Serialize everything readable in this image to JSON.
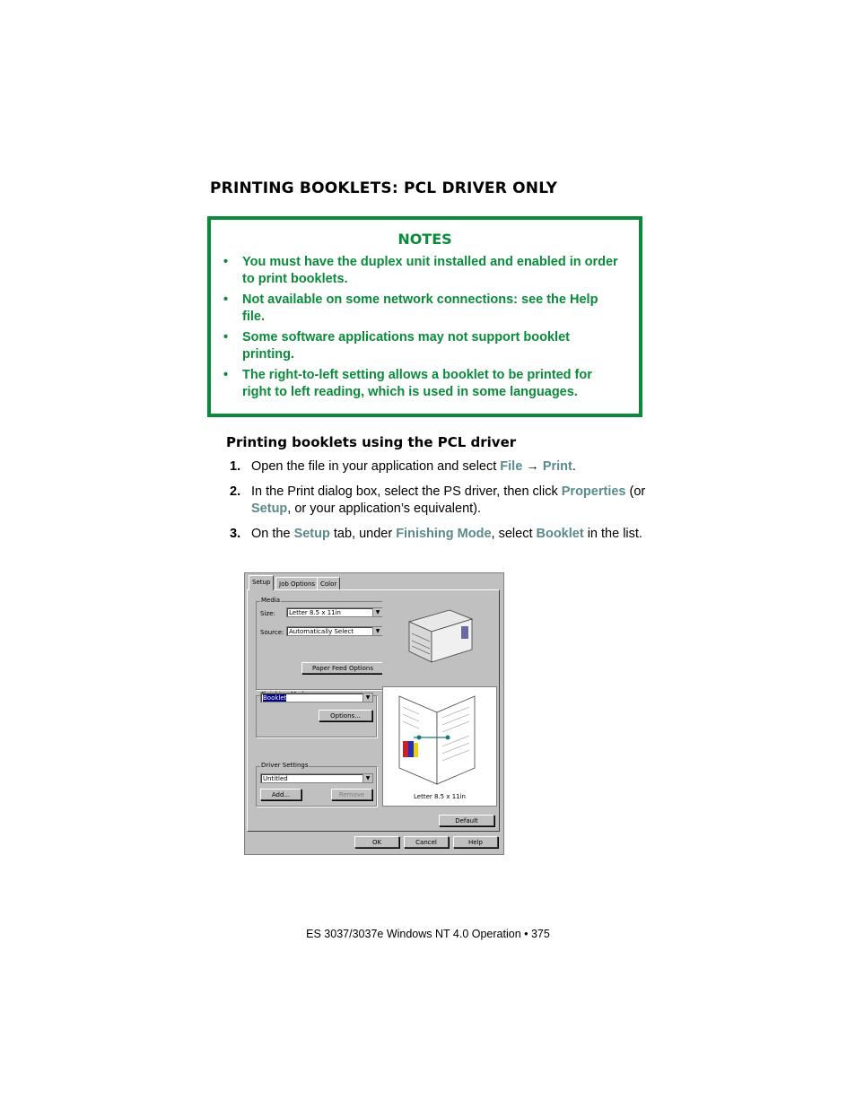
{
  "section_title": "PRINTING BOOKLETS: PCL DRIVER ONLY",
  "notes": {
    "title": "NOTES",
    "bullet": "•",
    "items": [
      "You must have the duplex unit installed and enabled in order to print booklets.",
      "Not available on some network connections: see the Help file.",
      "Some software applications may not support booklet printing.",
      "The right-to-left setting allows a booklet to be printed for right to left reading, which is used in some languages."
    ],
    "color": "#0a8a3a"
  },
  "subheading": "Printing booklets using the PCL driver",
  "steps": [
    {
      "num": "1.",
      "parts": [
        {
          "t": "Open the file in your application and select "
        },
        {
          "t": "File",
          "k": true
        },
        {
          "t": " → "
        },
        {
          "t": "Print",
          "k": true
        },
        {
          "t": "."
        }
      ]
    },
    {
      "num": "2.",
      "parts": [
        {
          "t": "In the Print dialog box, select the  PS driver, then click "
        },
        {
          "t": "Properties",
          "k": true
        },
        {
          "t": " (or "
        },
        {
          "t": "Setup",
          "k": true
        },
        {
          "t": ", or your application’s equivalent)."
        }
      ]
    },
    {
      "num": "3.",
      "parts": [
        {
          "t": "On the "
        },
        {
          "t": "Setup",
          "k": true
        },
        {
          "t": " tab, under "
        },
        {
          "t": "Finishing Mode",
          "k": true
        },
        {
          "t": ", select "
        },
        {
          "t": "Booklet",
          "k": true
        },
        {
          "t": " in the list."
        }
      ]
    }
  ],
  "dialog": {
    "tabs": [
      "Setup",
      "Job Options",
      "Color"
    ],
    "media_group": "Media",
    "size_label": "Size:",
    "size_value": "Letter 8.5 x 11in",
    "source_label": "Source:",
    "source_value": "Automatically Select",
    "paper_feed_button": "Paper Feed Options",
    "finishing_group": "Finishing Mode",
    "finishing_value": "Booklet",
    "options_button": "Options...",
    "driver_settings_group": "Driver Settings",
    "driver_settings_value": "Untitled",
    "add_button": "Add...",
    "remove_button": "Remove",
    "preview_caption": "Letter 8.5 x 11in",
    "default_button": "Default",
    "ok_button": "OK",
    "cancel_button": "Cancel",
    "help_button": "Help",
    "dropdown_arrow": "▼"
  },
  "footer": "ES 3037/3037e Windows NT 4.0 Operation • 375"
}
